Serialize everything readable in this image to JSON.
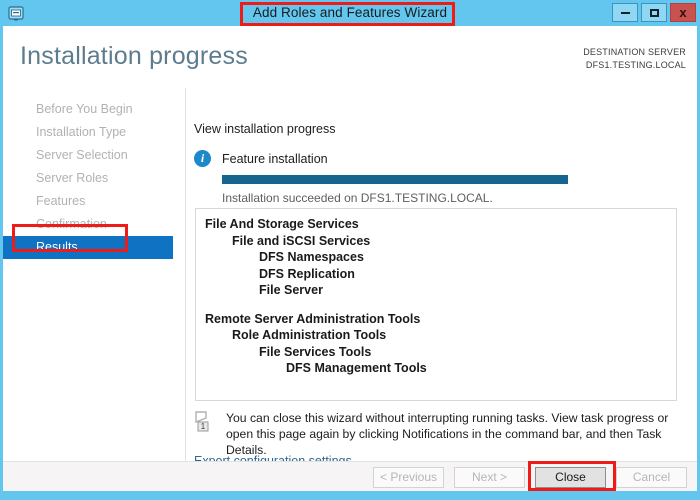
{
  "window": {
    "title": "Add Roles and Features Wizard",
    "app_icon": "server-manager-icon",
    "controls": {
      "minimize": "minimize-icon",
      "maximize": "maximize-icon",
      "close": "x"
    },
    "frame_color": "#62c6ef",
    "close_button_color": "#c9524f"
  },
  "header": {
    "page_title": "Installation progress",
    "destination_label": "DESTINATION SERVER",
    "destination_server": "DFS1.TESTING.LOCAL"
  },
  "sidebar": {
    "items": [
      {
        "label": "Before You Begin",
        "active": false
      },
      {
        "label": "Installation Type",
        "active": false
      },
      {
        "label": "Server Selection",
        "active": false
      },
      {
        "label": "Server Roles",
        "active": false
      },
      {
        "label": "Features",
        "active": false
      },
      {
        "label": "Confirmation",
        "active": false
      },
      {
        "label": "Results",
        "active": true
      }
    ],
    "active_color": "#0f72c3",
    "inactive_color": "#b2b2b2"
  },
  "main": {
    "view_label": "View installation progress",
    "info_icon": "info-icon",
    "feature_label": "Feature installation",
    "progress": {
      "percent": 100,
      "fill_color": "#16658f"
    },
    "progress_note": "Installation succeeded on DFS1.TESTING.LOCAL.",
    "results_tree": [
      {
        "label": "File And Storage Services",
        "level": 0
      },
      {
        "label": "File and iSCSI Services",
        "level": 1
      },
      {
        "label": "DFS Namespaces",
        "level": 2
      },
      {
        "label": "DFS Replication",
        "level": 2
      },
      {
        "label": "File Server",
        "level": 2
      },
      {
        "label": "Remote Server Administration Tools",
        "level": 0
      },
      {
        "label": "Role Administration Tools",
        "level": 1
      },
      {
        "label": "File Services Tools",
        "level": 2
      },
      {
        "label": "DFS Management Tools",
        "level": 3
      }
    ],
    "note_icon": "notifications-flag-icon",
    "note_badge": "1",
    "note_text": "You can close this wizard without interrupting running tasks. View task progress or open this page again by clicking Notifications in the command bar, and then Task Details.",
    "export_link": "Export configuration settings",
    "link_color": "#2c6a8f"
  },
  "footer": {
    "buttons": [
      {
        "label": "< Previous",
        "enabled": false
      },
      {
        "label": "Next >",
        "enabled": false
      },
      {
        "label": "Close",
        "enabled": true
      },
      {
        "label": "Cancel",
        "enabled": false
      }
    ]
  },
  "annotations": {
    "color": "#ee1b19",
    "targets": [
      "window-title",
      "sidebar-item-results",
      "close-button"
    ]
  }
}
